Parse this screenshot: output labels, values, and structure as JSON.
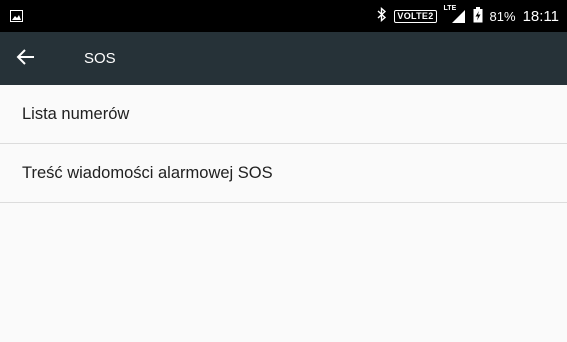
{
  "status_bar": {
    "left_icon": "image-icon",
    "bluetooth_icon": "bluetooth-icon",
    "volte_badge": "VOLTE2",
    "signal_icon": "signal-lte-icon",
    "network_type": "LTE",
    "battery_icon": "battery-charging-icon",
    "battery_percent": "81%",
    "time": "18:11"
  },
  "app_bar": {
    "back_icon": "arrow-back-icon",
    "title": "SOS",
    "background": "#263238"
  },
  "list": {
    "items": [
      {
        "label": "Lista numerów"
      },
      {
        "label": "Treść wiadomości alarmowej SOS"
      }
    ]
  }
}
